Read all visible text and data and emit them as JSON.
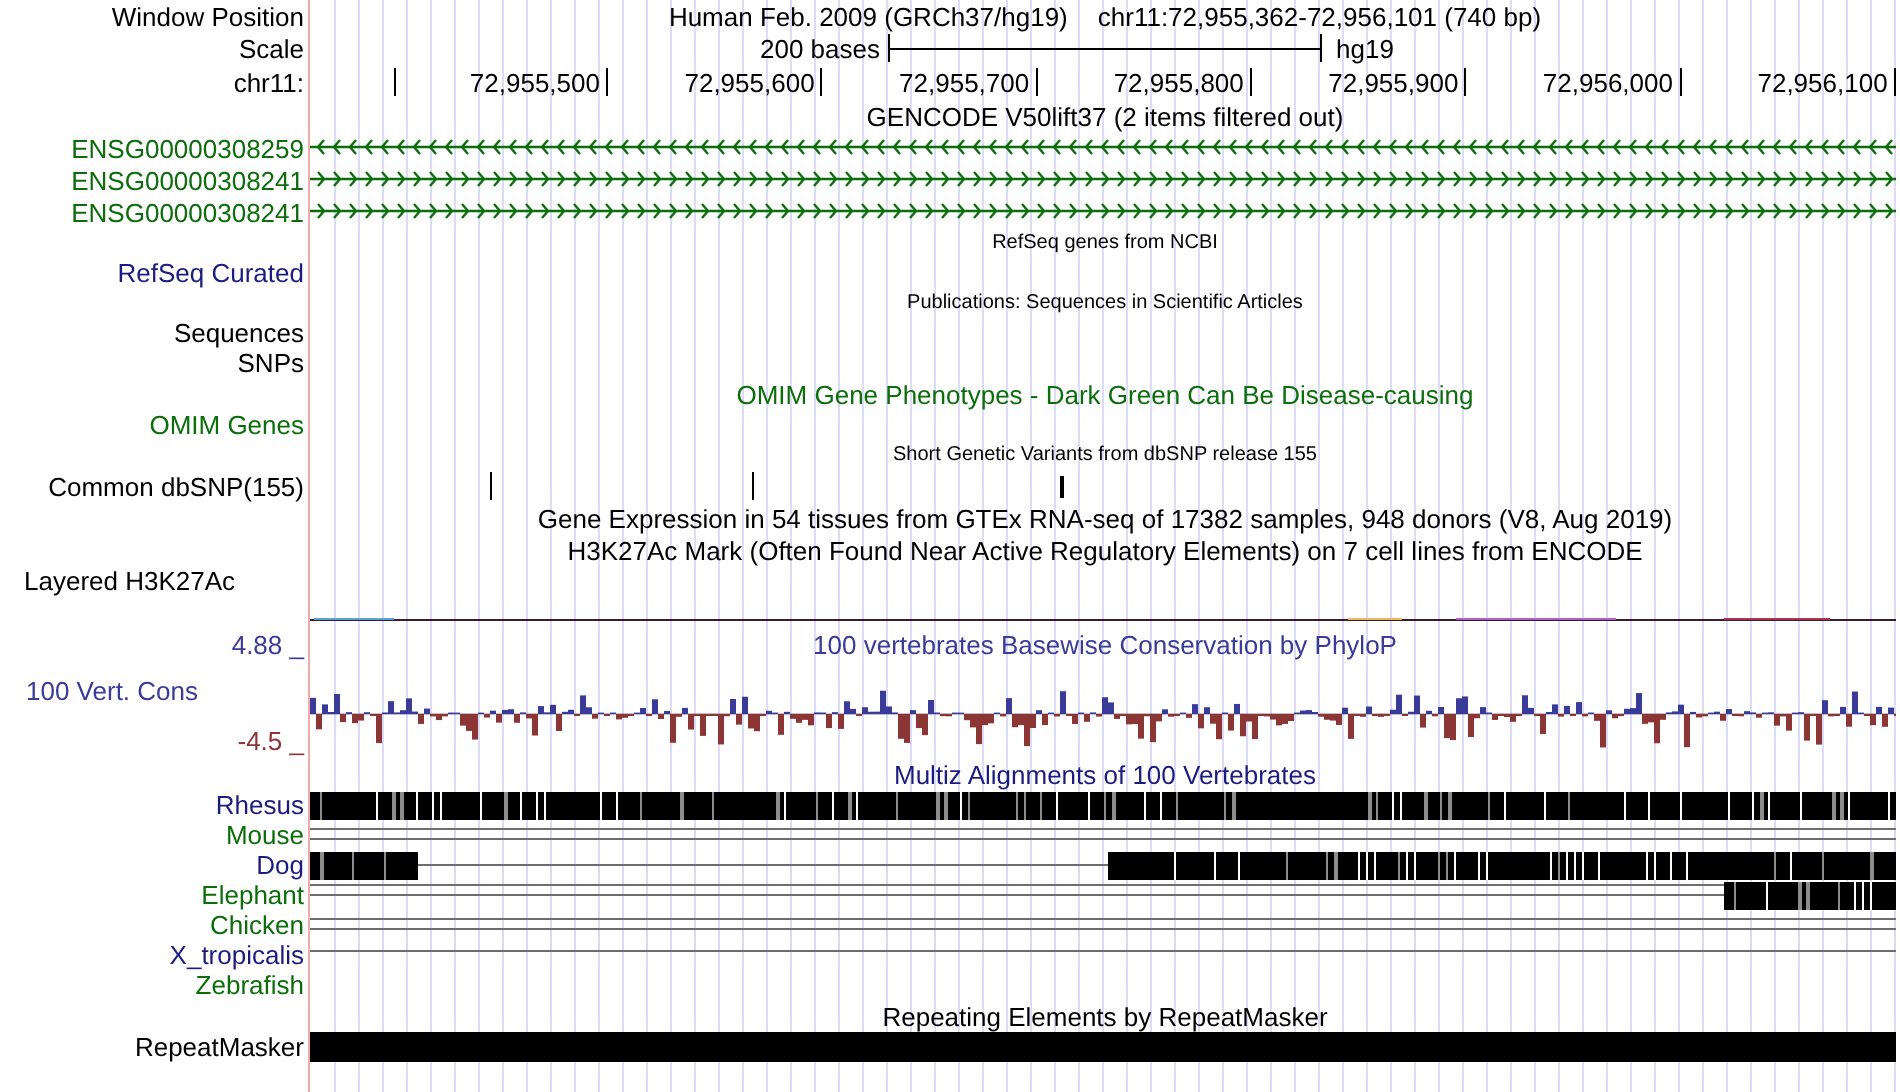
{
  "rows": [
    {
      "kind": "position",
      "label": "Window Position",
      "assembly": "Human Feb. 2009 (GRCh37/hg19)",
      "range": "chr11:72,955,362-72,956,101 (740 bp)"
    },
    {
      "kind": "scale",
      "label": "Scale",
      "text": "200 bases",
      "assembly": "hg19"
    },
    {
      "kind": "ruler",
      "label": "chr11:",
      "ticks": [
        "72,955,500",
        "72,955,600",
        "72,955,700",
        "72,955,800",
        "72,955,900",
        "72,956,000",
        "72,956,100"
      ]
    },
    {
      "kind": "title",
      "text": "GENCODE V50lift37 (2 items filtered out)"
    },
    {
      "kind": "gene",
      "label": "ENSG00000308259",
      "color": "#0b6e0b",
      "arrows": {
        "kind": "reverse"
      }
    },
    {
      "kind": "gene",
      "label": "ENSG00000308241",
      "color": "#0b6e0b",
      "arrows": {
        "kind": "forward"
      }
    },
    {
      "kind": "gene",
      "label": "ENSG00000308241",
      "color": "#0b6e0b",
      "arrows": {
        "kind": "forward"
      }
    },
    {
      "kind": "small-title",
      "text": "RefSeq genes from NCBI"
    },
    {
      "kind": "label",
      "label": "RefSeq Curated",
      "color": "#1c1c80"
    },
    {
      "kind": "small-title",
      "text": "Publications: Sequences in Scientific Articles"
    },
    {
      "kind": "label",
      "label": "Sequences",
      "color": "#000000"
    },
    {
      "kind": "label",
      "label": "SNPs",
      "color": "#000000"
    },
    {
      "kind": "title",
      "text": "OMIM Gene Phenotypes - Dark Green Can Be Disease-causing",
      "color": "#0b6e0b"
    },
    {
      "kind": "label",
      "label": "OMIM Genes",
      "color": "#0b6e0b"
    },
    {
      "kind": "small-title",
      "text": "Short Genetic Variants from dbSNP release 155"
    },
    {
      "kind": "snp",
      "label": "Common dbSNP(155)"
    },
    {
      "kind": "title",
      "text": "Gene Expression in 54 tissues from GTEx RNA-seq of 17382 samples, 948 donors (V8, Aug 2019)"
    },
    {
      "kind": "title",
      "text": "H3K27Ac Mark (Often Found Near Active Regulatory Elements) on 7 cell lines from ENCODE"
    },
    {
      "kind": "layered",
      "label": "Layered H3K27Ac"
    },
    {
      "kind": "conservation",
      "top": "4.88 _",
      "label": "100 Vert. Cons",
      "bottom": "-4.5 _",
      "title": "100 vertebrates Basewise Conservation by PhyloP"
    },
    {
      "kind": "title",
      "text": "Multiz Alignments of 100 Vertebrates",
      "color": "#1c1c80"
    },
    {
      "kind": "species",
      "label": "Rhesus",
      "color": "#1c1c80",
      "track": {
        "kind": "full"
      }
    },
    {
      "kind": "species",
      "label": "Mouse",
      "color": "#0b6e0b",
      "track": {
        "kind": "double"
      }
    },
    {
      "kind": "species",
      "label": "Dog",
      "color": "#1c1c80",
      "track": {
        "kind": "split"
      }
    },
    {
      "kind": "species",
      "label": "Elephant",
      "color": "#0b6e0b",
      "track": {
        "kind": "double-tail"
      }
    },
    {
      "kind": "species",
      "label": "Chicken",
      "color": "#0b6e0b",
      "track": {
        "kind": "double"
      }
    },
    {
      "kind": "species",
      "label": "X_tropicalis",
      "color": "#1c1c80",
      "track": {
        "kind": "single"
      }
    },
    {
      "kind": "species",
      "label": "Zebrafish",
      "color": "#0b6e0b",
      "track": {
        "kind": "none"
      }
    },
    {
      "kind": "title",
      "text": "Repeating Elements by RepeatMasker"
    },
    {
      "kind": "repeat",
      "label": "RepeatMasker"
    }
  ]
}
